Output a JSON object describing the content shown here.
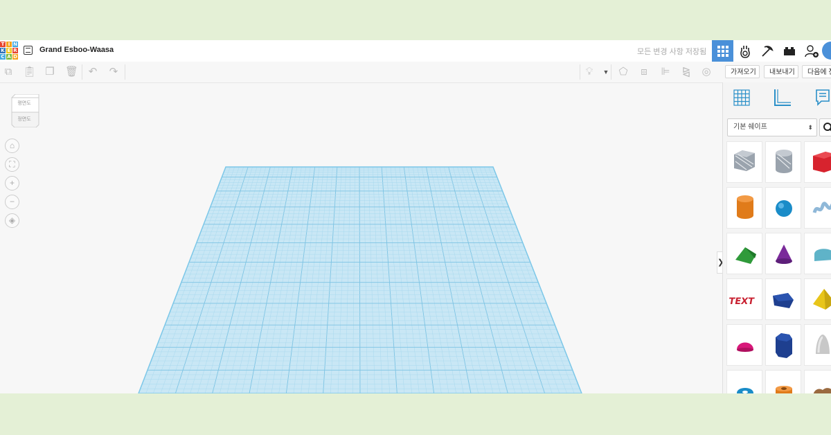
{
  "app": {
    "logo_letters": [
      "T",
      "I",
      "N",
      "K",
      "E",
      "R",
      "C",
      "A",
      "D"
    ],
    "logo_colors": [
      "#e8432c",
      "#f7a21b",
      "#41a8e1",
      "#2e6fb7",
      "#f0c419",
      "#e8432c",
      "#41a8e1",
      "#79b93d",
      "#f7a21b"
    ],
    "project_title": "Grand Esboo-Waasa",
    "save_status": "모든 변경 사항 저장됨"
  },
  "topbar": {
    "icons": [
      "3d-design-icon",
      "circuits-icon",
      "codeblocks-icon",
      "bricks-icon",
      "add-user-icon",
      "profile-icon"
    ],
    "active_color": "#4a90d9"
  },
  "toolbar": {
    "import_label": "가져오기",
    "export_label": "내보내기",
    "send_label": "다음에 전송"
  },
  "viewcube": {
    "top_label": "평면도",
    "front_label": "정면도"
  },
  "panel": {
    "shapes_select": "기본 쉐이프",
    "collapse_glyph": "❯"
  },
  "shapes": [
    {
      "name": "box-hole",
      "color": "#9aa3ad"
    },
    {
      "name": "cylinder-hole",
      "color": "#9aa3ad"
    },
    {
      "name": "box",
      "color": "#d7232e"
    },
    {
      "name": "cylinder",
      "color": "#e07b1a"
    },
    {
      "name": "sphere",
      "color": "#1a8cc8"
    },
    {
      "name": "scribble",
      "color": "#8fb8d8"
    },
    {
      "name": "roof",
      "color": "#2f9a3a"
    },
    {
      "name": "cone",
      "color": "#7a2a9a"
    },
    {
      "name": "round-roof",
      "color": "#5fb3c8"
    },
    {
      "name": "text",
      "color": "#c82030"
    },
    {
      "name": "polygon",
      "color": "#1e3f8f"
    },
    {
      "name": "pyramid",
      "color": "#e8c51a"
    },
    {
      "name": "half-sphere",
      "color": "#d8187a"
    },
    {
      "name": "hexagonal-prism",
      "color": "#1e3f8f"
    },
    {
      "name": "paraboloid",
      "color": "#c8c8c8"
    },
    {
      "name": "torus",
      "color": "#1a8cc8"
    },
    {
      "name": "tube",
      "color": "#e07b1a"
    },
    {
      "name": "shape-generator",
      "color": "#9a6a40"
    }
  ]
}
